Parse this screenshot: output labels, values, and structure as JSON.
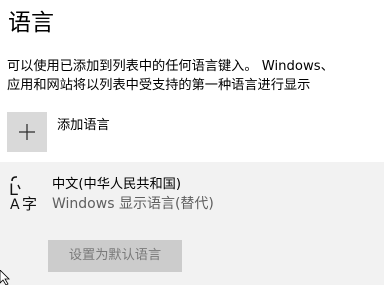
{
  "page": {
    "title": "语言",
    "description_line1": "可以使用已添加到列表中的任何语言键入。 Windows、",
    "description_line2": "应用和网站将以列表中受支持的第一种语言进行显示"
  },
  "add_language": {
    "label": "添加语言",
    "icon": "plus-icon"
  },
  "languages": [
    {
      "name": "中文(中华人民共和国)",
      "subtitle": "Windows 显示语言(替代)",
      "icon": "language-icon",
      "set_default_label": "设置为默认语言"
    }
  ],
  "colors": {
    "add_box": "#d9d9d9",
    "card_background": "#f2f2f2",
    "button_disabled_bg": "#cccccc",
    "button_disabled_text": "#7a7a7a"
  }
}
